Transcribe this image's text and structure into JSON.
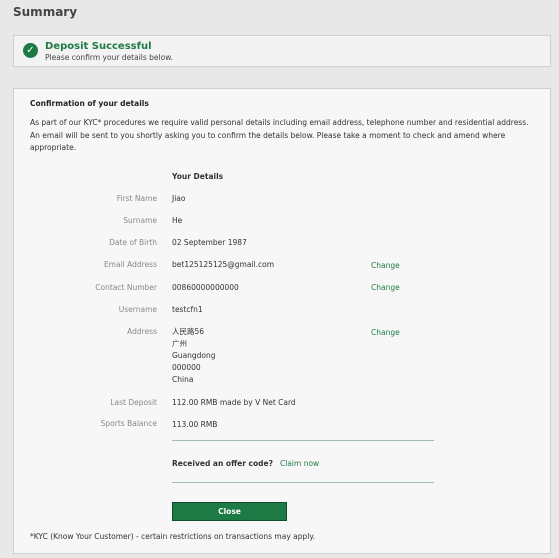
{
  "page": {
    "title": "Summary"
  },
  "success": {
    "icon": "checkmark-icon",
    "title": "Deposit Successful",
    "subtitle": "Please confirm your details below."
  },
  "confirmation": {
    "heading": "Confirmation of your details",
    "intro_line1": "As part of our KYC* procedures we require valid personal details including email address, telephone number and residential address.",
    "intro_line2": "An email will be sent to you shortly asking you to confirm the details below. Please take a moment to check and amend where appropriate.",
    "section_title": "Your Details",
    "fields": {
      "first_name": {
        "label": "First Name",
        "value": "Jiao"
      },
      "surname": {
        "label": "Surname",
        "value": "He"
      },
      "dob": {
        "label": "Date of Birth",
        "value": "02 September 1987"
      },
      "email": {
        "label": "Email Address",
        "value": "bet125125125@gmail.com",
        "action": "Change"
      },
      "contact": {
        "label": "Contact Number",
        "value": "00860000000000",
        "action": "Change"
      },
      "username": {
        "label": "Username",
        "value": "testcfn1"
      },
      "address": {
        "label": "Address",
        "line1": "人民路56",
        "line2": "广州",
        "line3": "Guangdong",
        "line4": "000000",
        "line5": "China",
        "action": "Change"
      },
      "last_deposit": {
        "label": "Last Deposit",
        "value": "112.00 RMB made by V Net Card"
      },
      "sports_balance": {
        "label": "Sports Balance",
        "value": "113.00 RMB"
      }
    },
    "offer": {
      "question": "Received an offer code?",
      "link": "Claim now"
    },
    "close_label": "Close",
    "footnote": "*KYC (Know Your Customer) - certain restrictions on transactions may apply."
  },
  "colors": {
    "accent": "#1e7a45",
    "background": "#e8e8e8",
    "panel": "#f7f7f7"
  }
}
